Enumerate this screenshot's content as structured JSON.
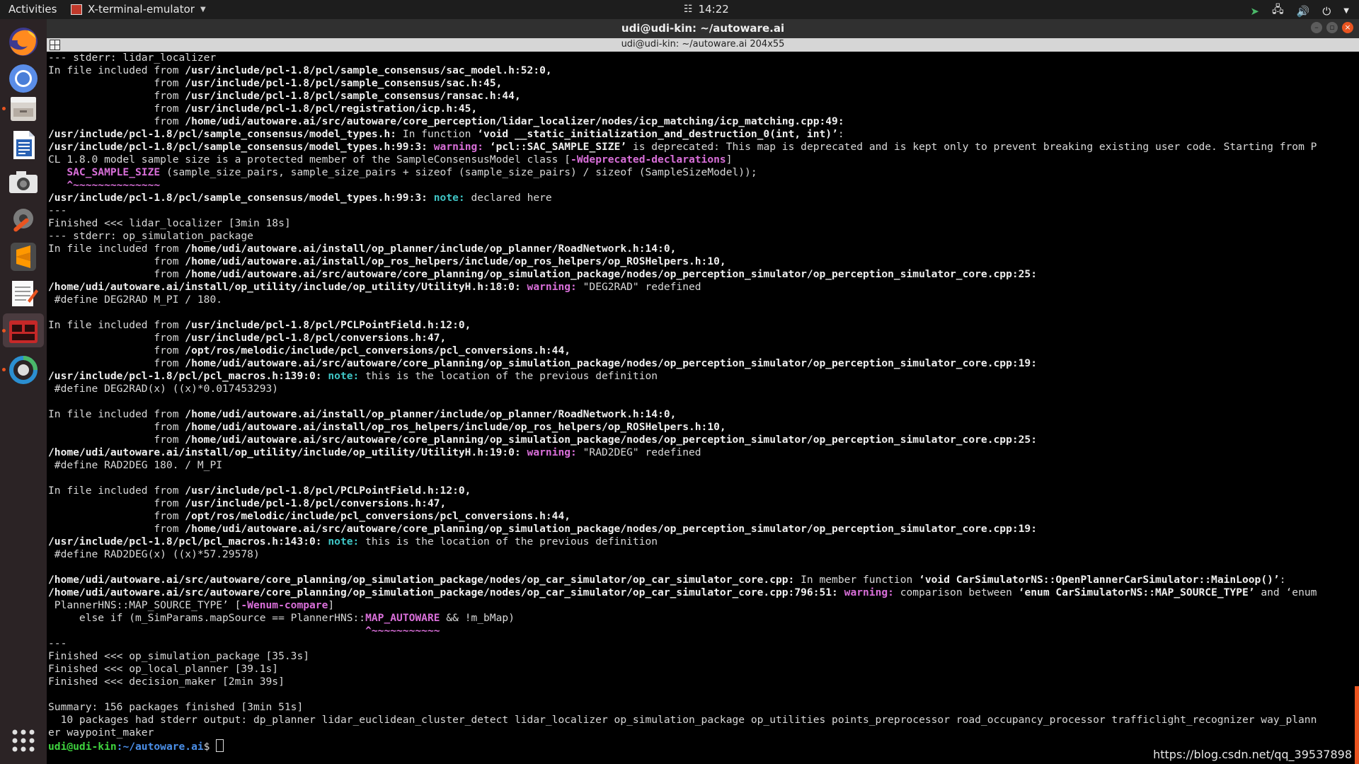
{
  "topbar": {
    "activities": "Activities",
    "app_name": "X-terminal-emulator",
    "clock": "14:22"
  },
  "window": {
    "title": "udi@udi-kin: ~/autoware.ai",
    "tab_title": "udi@udi-kin: ~/autoware.ai 204x55"
  },
  "dock": {
    "items": [
      "Firefox",
      "Chromium",
      "Files",
      "LibreOffice Writer",
      "Screenshot",
      "Settings",
      "Sublime Text",
      "Text Editor",
      "Terminal",
      "Update"
    ]
  },
  "terminal": {
    "lines": [
      "--- stderr: lidar_localizer",
      "In file included from /usr/include/pcl-1.8/pcl/sample_consensus/sac_model.h:52:0,",
      "                 from /usr/include/pcl-1.8/pcl/sample_consensus/sac.h:45,",
      "                 from /usr/include/pcl-1.8/pcl/sample_consensus/ransac.h:44,",
      "                 from /usr/include/pcl-1.8/pcl/registration/icp.h:45,",
      "                 from /home/udi/autoware.ai/src/autoware/core_perception/lidar_localizer/nodes/icp_matching/icp_matching.cpp:49:",
      "/usr/include/pcl-1.8/pcl/sample_consensus/model_types.h: In function ‘void __static_initialization_and_destruction_0(int, int)’:",
      "/usr/include/pcl-1.8/pcl/sample_consensus/model_types.h:99:3: warning: ‘pcl::SAC_SAMPLE_SIZE’ is deprecated: This map is deprecated and is kept only to prevent breaking existing user code. Starting from P",
      "CL 1.8.0 model sample size is a protected member of the SampleConsensusModel class [-Wdeprecated-declarations]",
      "   SAC_SAMPLE_SIZE (sample_size_pairs, sample_size_pairs + sizeof (sample_size_pairs) / sizeof (SampleSizeModel));",
      "   ^~~~~~~~~~~~~~~",
      "/usr/include/pcl-1.8/pcl/sample_consensus/model_types.h:99:3: note: declared here",
      "---",
      "Finished <<< lidar_localizer [3min 18s]",
      "--- stderr: op_simulation_package",
      "In file included from /home/udi/autoware.ai/install/op_planner/include/op_planner/RoadNetwork.h:14:0,",
      "                 from /home/udi/autoware.ai/install/op_ros_helpers/include/op_ros_helpers/op_ROSHelpers.h:10,",
      "                 from /home/udi/autoware.ai/src/autoware/core_planning/op_simulation_package/nodes/op_perception_simulator/op_perception_simulator_core.cpp:25:",
      "/home/udi/autoware.ai/install/op_utility/include/op_utility/UtilityH.h:18:0: warning: \"DEG2RAD\" redefined",
      " #define DEG2RAD M_PI / 180.",
      "",
      "In file included from /usr/include/pcl-1.8/pcl/PCLPointField.h:12:0,",
      "                 from /usr/include/pcl-1.8/pcl/conversions.h:47,",
      "                 from /opt/ros/melodic/include/pcl_conversions/pcl_conversions.h:44,",
      "                 from /home/udi/autoware.ai/src/autoware/core_planning/op_simulation_package/nodes/op_perception_simulator/op_perception_simulator_core.cpp:19:",
      "/usr/include/pcl-1.8/pcl/pcl_macros.h:139:0: note: this is the location of the previous definition",
      " #define DEG2RAD(x) ((x)*0.017453293)",
      "",
      "In file included from /home/udi/autoware.ai/install/op_planner/include/op_planner/RoadNetwork.h:14:0,",
      "                 from /home/udi/autoware.ai/install/op_ros_helpers/include/op_ros_helpers/op_ROSHelpers.h:10,",
      "                 from /home/udi/autoware.ai/src/autoware/core_planning/op_simulation_package/nodes/op_perception_simulator/op_perception_simulator_core.cpp:25:",
      "/home/udi/autoware.ai/install/op_utility/include/op_utility/UtilityH.h:19:0: warning: \"RAD2DEG\" redefined",
      " #define RAD2DEG 180. / M_PI",
      "",
      "In file included from /usr/include/pcl-1.8/pcl/PCLPointField.h:12:0,",
      "                 from /usr/include/pcl-1.8/pcl/conversions.h:47,",
      "                 from /opt/ros/melodic/include/pcl_conversions/pcl_conversions.h:44,",
      "                 from /home/udi/autoware.ai/src/autoware/core_planning/op_simulation_package/nodes/op_perception_simulator/op_perception_simulator_core.cpp:19:",
      "/usr/include/pcl-1.8/pcl/pcl_macros.h:143:0: note: this is the location of the previous definition",
      " #define RAD2DEG(x) ((x)*57.29578)",
      "",
      "/home/udi/autoware.ai/src/autoware/core_planning/op_simulation_package/nodes/op_car_simulator/op_car_simulator_core.cpp: In member function ‘void CarSimulatorNS::OpenPlannerCarSimulator::MainLoop()’:",
      "/home/udi/autoware.ai/src/autoware/core_planning/op_simulation_package/nodes/op_car_simulator/op_car_simulator_core.cpp:796:51: warning: comparison between ‘enum CarSimulatorNS::MAP_SOURCE_TYPE’ and ‘enum",
      " PlannerHNS::MAP_SOURCE_TYPE’ [-Wenum-compare]",
      "     else if (m_SimParams.mapSource == PlannerHNS::MAP_AUTOWARE && !m_bMap)",
      "                                                   ^~~~~~~~~~~~",
      "---",
      "Finished <<< op_simulation_package [35.3s]",
      "Finished <<< op_local_planner [39.1s]",
      "Finished <<< decision_maker [2min 39s]",
      "",
      "Summary: 156 packages finished [3min 51s]",
      "  10 packages had stderr output: dp_planner lidar_euclidean_cluster_detect lidar_localizer op_simulation_package op_utilities points_preprocessor road_occupancy_processor trafficlight_recognizer way_plann",
      "er waypoint_maker"
    ],
    "prompt_user": "udi@udi-kin",
    "prompt_path": ":~/autoware.ai",
    "prompt_symbol": "$ "
  },
  "watermark": "https://blog.csdn.net/qq_39537898",
  "colors": {
    "terminal_bg": "#000000",
    "terminal_fg": "#d9d9d9",
    "warning": "#d96fd9",
    "note": "#3fc5c5",
    "prompt": "#3fd43f",
    "accent": "#e95420"
  }
}
